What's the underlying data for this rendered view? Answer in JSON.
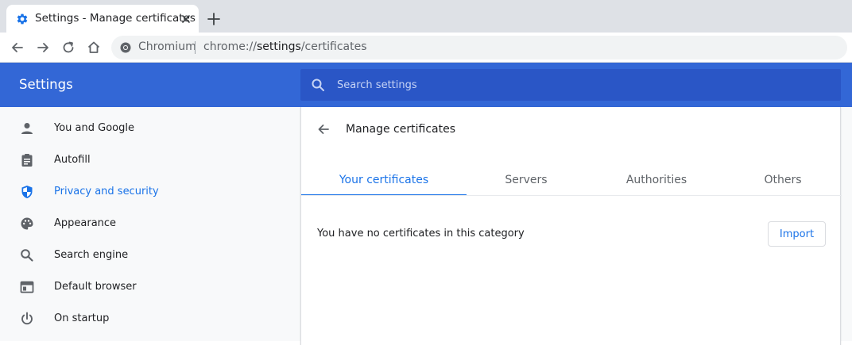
{
  "browser": {
    "tab": {
      "title": "Settings - Manage certificates"
    },
    "address_bar": {
      "chip": "Chromium",
      "url_scheme": "chrome://",
      "url_host": "settings",
      "url_path": "/certificates"
    }
  },
  "header": {
    "title": "Settings",
    "search_placeholder": "Search settings"
  },
  "sidebar": {
    "items": [
      {
        "label": "You and Google",
        "icon": "person-icon"
      },
      {
        "label": "Autofill",
        "icon": "clipboard-icon"
      },
      {
        "label": "Privacy and security",
        "icon": "shield-icon",
        "active": true
      },
      {
        "label": "Appearance",
        "icon": "palette-icon"
      },
      {
        "label": "Search engine",
        "icon": "search-icon"
      },
      {
        "label": "Default browser",
        "icon": "browser-window-icon"
      },
      {
        "label": "On startup",
        "icon": "power-icon"
      }
    ]
  },
  "main": {
    "title": "Manage certificates",
    "tabs": [
      {
        "label": "Your certificates",
        "active": true
      },
      {
        "label": "Servers"
      },
      {
        "label": "Authorities"
      },
      {
        "label": "Others"
      }
    ],
    "empty_message": "You have no certificates in this category",
    "import_label": "Import"
  },
  "colors": {
    "header_bg": "#3367d6",
    "search_bg": "#2a56c6",
    "accent": "#1a73e8",
    "tabstrip_bg": "#dee1e6"
  }
}
